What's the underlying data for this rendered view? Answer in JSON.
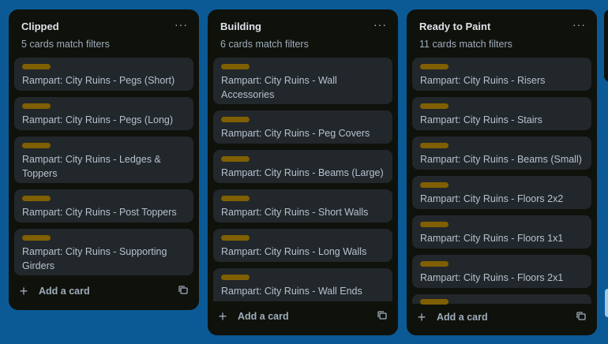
{
  "colors": {
    "board_background": "#0b5a96",
    "list_background": "#0f110b",
    "card_background": "#22272b",
    "label": "#7f5f01"
  },
  "icons": {
    "menu": "ellipsis-icon",
    "add": "plus-icon",
    "template": "card-template-icon"
  },
  "lists": [
    {
      "title": "Clipped",
      "menu": "···",
      "filter_text": "5 cards match filters",
      "cards": [
        {
          "title": "Rampart: City Ruins - Pegs (Short)"
        },
        {
          "title": "Rampart: City Ruins - Pegs (Long)"
        },
        {
          "title": "Rampart: City Ruins - Ledges & Toppers"
        },
        {
          "title": "Rampart: City Ruins - Post Toppers"
        },
        {
          "title": "Rampart: City Ruins - Supporting Girders"
        }
      ],
      "add_card": "Add a card"
    },
    {
      "title": "Building",
      "menu": "···",
      "filter_text": "6 cards match filters",
      "cards": [
        {
          "title": "Rampart: City Ruins - Wall Accessories"
        },
        {
          "title": "Rampart: City Ruins - Peg Covers"
        },
        {
          "title": "Rampart: City Ruins - Beams (Large)"
        },
        {
          "title": "Rampart: City Ruins - Short Walls"
        },
        {
          "title": "Rampart: City Ruins - Long Walls"
        },
        {
          "title": "Rampart: City Ruins - Wall Ends"
        }
      ],
      "add_card": "Add a card"
    },
    {
      "title": "Ready to Paint",
      "menu": "···",
      "filter_text": "11 cards match filters",
      "cards": [
        {
          "title": "Rampart: City Ruins - Risers"
        },
        {
          "title": "Rampart: City Ruins - Stairs"
        },
        {
          "title": "Rampart: City Ruins - Beams (Small)"
        },
        {
          "title": "Rampart: City Ruins - Floors 2x2"
        },
        {
          "title": "Rampart: City Ruins - Floors 1x1"
        },
        {
          "title": "Rampart: City Ruins - Floors 2x1"
        }
      ],
      "add_card": "Add a card"
    }
  ]
}
